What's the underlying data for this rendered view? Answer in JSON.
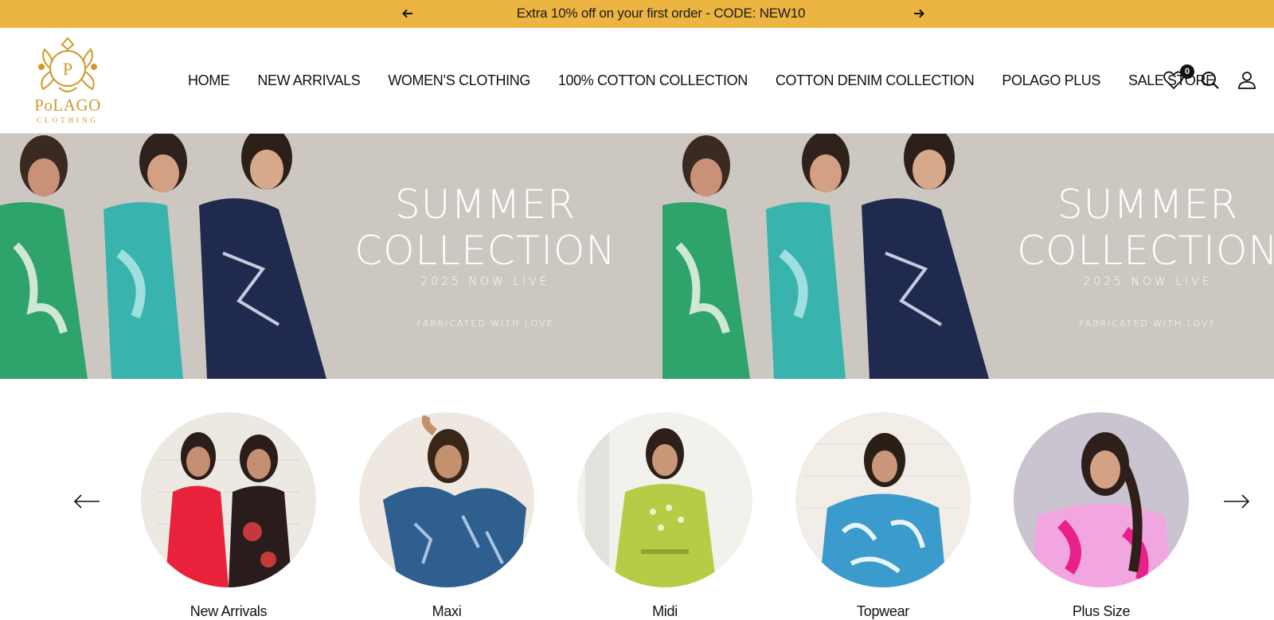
{
  "announcement": {
    "text": "Extra 10% off on your first order - CODE: NEW10",
    "prev_icon": "arrow-left-icon",
    "next_icon": "arrow-right-icon"
  },
  "brand": {
    "name": "PoLAGO",
    "tagline": "CLOTHING",
    "monogram": "P",
    "color": "#cf9a2c"
  },
  "nav": {
    "items": [
      {
        "label": "HOME"
      },
      {
        "label": "NEW ARRIVALS"
      },
      {
        "label": "WOMEN’S CLOTHING"
      },
      {
        "label": "100% COTTON COLLECTION"
      },
      {
        "label": "COTTON DENIM COLLECTION"
      },
      {
        "label": "POLAGO PLUS"
      },
      {
        "label": "SALE STORE"
      }
    ]
  },
  "header_icons": {
    "wishlist_count": "0",
    "icons": [
      "heart-icon",
      "search-icon",
      "account-icon"
    ]
  },
  "hero": {
    "title_line1": "SUMMER",
    "title_line2": "COLLECTION",
    "subtitle": "2025 NOW LIVE",
    "tagline": "FABRICATED WITH LOVE",
    "background": "#ccc8c1"
  },
  "categories": [
    {
      "label": "New Arrivals"
    },
    {
      "label": "Maxi"
    },
    {
      "label": "Midi"
    },
    {
      "label": "Topwear"
    },
    {
      "label": "Plus Size"
    }
  ],
  "colors": {
    "announcement_bg": "#ecb440",
    "text": "#111111"
  }
}
